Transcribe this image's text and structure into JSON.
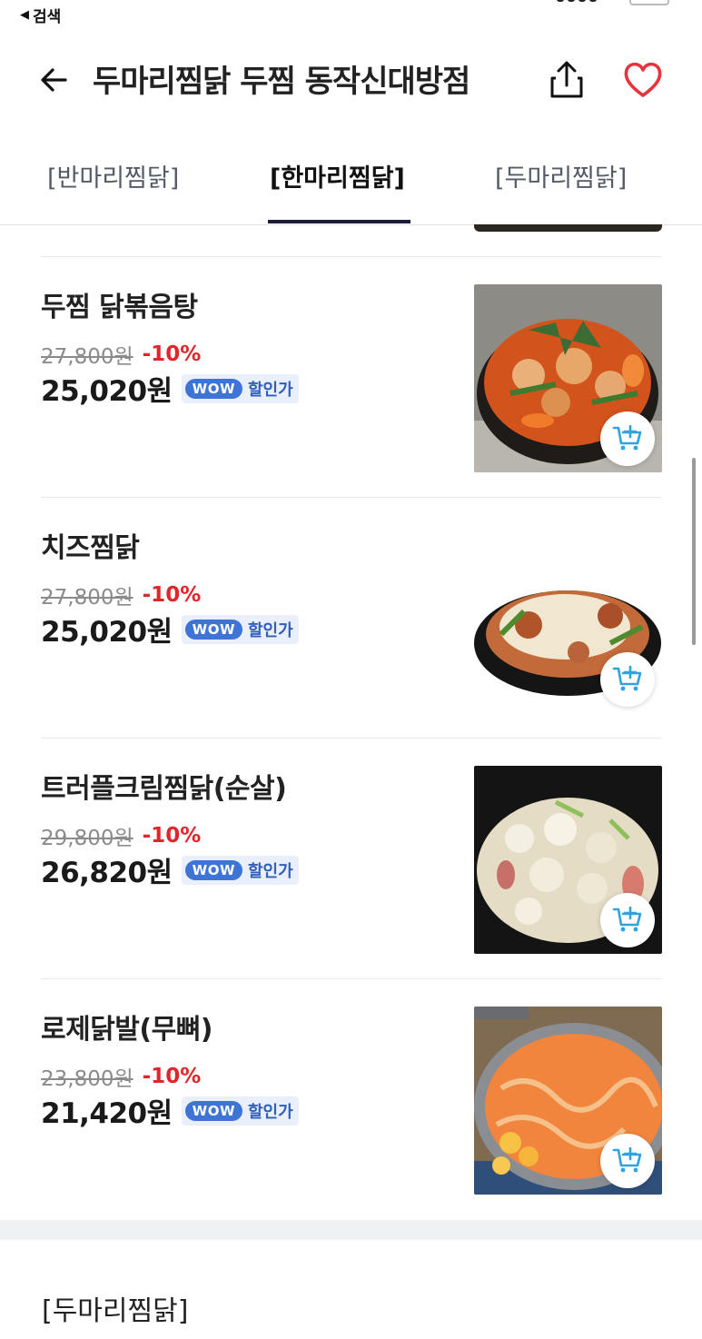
{
  "status_bar": {
    "back_label": "검색"
  },
  "header": {
    "title": "두마리찜닭 두찜 동작신대방점"
  },
  "tabs": [
    {
      "label": "[반마리찜닭]",
      "active": false
    },
    {
      "label": "[한마리찜닭]",
      "active": true
    },
    {
      "label": "[두마리찜닭]",
      "active": false
    }
  ],
  "badge": {
    "wow": "WOW",
    "text": "할인가"
  },
  "items": [
    {
      "name": "두찜 닭볶음탕",
      "original_price": "27,800원",
      "discount": "-10%",
      "sale_price": "25,020원"
    },
    {
      "name": "치즈찜닭",
      "original_price": "27,800원",
      "discount": "-10%",
      "sale_price": "25,020원"
    },
    {
      "name": "트러플크림찜닭(순살)",
      "original_price": "29,800원",
      "discount": "-10%",
      "sale_price": "26,820원"
    },
    {
      "name": "로제닭발(무뼈)",
      "original_price": "23,800원",
      "discount": "-10%",
      "sale_price": "21,420원"
    }
  ],
  "next_section": {
    "title": "[두마리찜닭]"
  },
  "colors": {
    "discount": "#e0262b",
    "wow_badge": "#3d74d6",
    "heart": "#e8333f",
    "cart_icon": "#2fa3e0",
    "tab_underline": "#1b1b3a"
  }
}
